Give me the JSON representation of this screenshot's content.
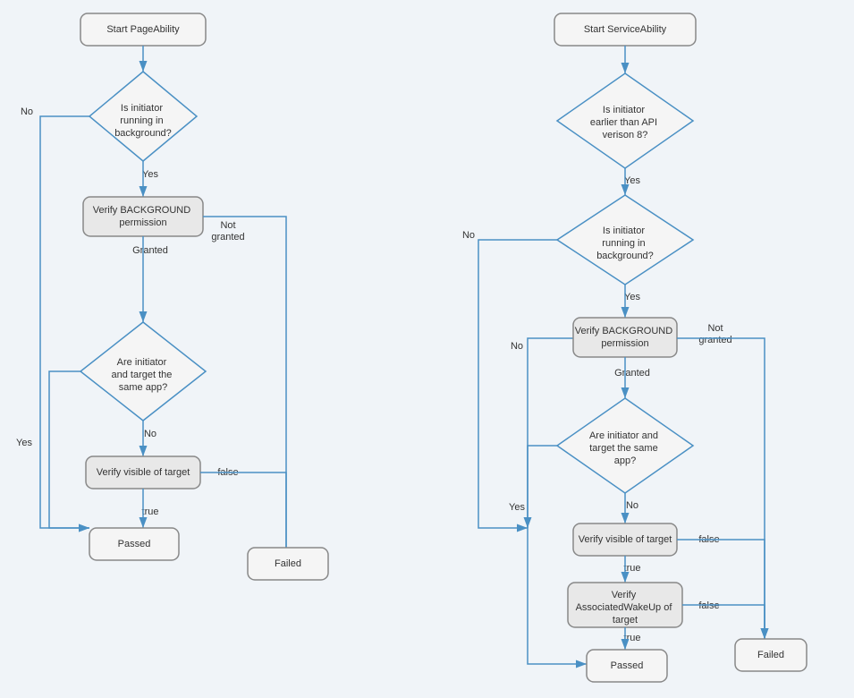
{
  "diagrams": {
    "left": {
      "title": "Start PageAbility",
      "nodes": [
        {
          "id": "start",
          "label": "Start PageAbility",
          "type": "rect"
        },
        {
          "id": "check_bg",
          "label": "Is initiator running in background?",
          "type": "diamond"
        },
        {
          "id": "verify_bg",
          "label": "Verify BACKGROUND permission",
          "type": "rect_dark"
        },
        {
          "id": "check_same",
          "label": "Are initiator and target the same app?",
          "type": "diamond"
        },
        {
          "id": "verify_visible",
          "label": "Verify visible of target",
          "type": "rect_dark"
        },
        {
          "id": "passed",
          "label": "Passed",
          "type": "rect"
        },
        {
          "id": "failed",
          "label": "Failed",
          "type": "rect"
        }
      ],
      "labels": {
        "yes": "Yes",
        "no": "No",
        "granted": "Granted",
        "not_granted": "Not granted",
        "true": "true",
        "false": "false"
      }
    },
    "right": {
      "title": "Start ServiceAbility",
      "nodes": [
        {
          "id": "start",
          "label": "Start ServiceAbility",
          "type": "rect"
        },
        {
          "id": "check_api",
          "label": "Is initiator earlier than API verison 8?",
          "type": "diamond"
        },
        {
          "id": "check_bg",
          "label": "Is initiator running in background?",
          "type": "diamond"
        },
        {
          "id": "verify_bg",
          "label": "Verify BACKGROUND permission",
          "type": "rect_dark"
        },
        {
          "id": "check_same",
          "label": "Are initiator and target the same app?",
          "type": "diamond"
        },
        {
          "id": "verify_visible",
          "label": "Verify visible of target",
          "type": "rect_dark"
        },
        {
          "id": "verify_wakeup",
          "label": "Verify AssociatedWakeUp of target",
          "type": "rect_dark"
        },
        {
          "id": "passed",
          "label": "Passed",
          "type": "rect"
        },
        {
          "id": "failed",
          "label": "Failed",
          "type": "rect"
        }
      ],
      "labels": {
        "yes": "Yes",
        "no": "No",
        "granted": "Granted",
        "not_granted": "Not granted",
        "true": "true",
        "false": "false"
      }
    }
  }
}
